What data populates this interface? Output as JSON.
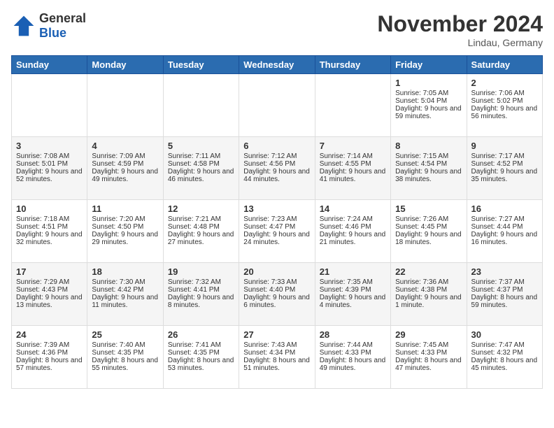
{
  "header": {
    "logo_general": "General",
    "logo_blue": "Blue",
    "month_title": "November 2024",
    "location": "Lindau, Germany"
  },
  "weekdays": [
    "Sunday",
    "Monday",
    "Tuesday",
    "Wednesday",
    "Thursday",
    "Friday",
    "Saturday"
  ],
  "weeks": [
    {
      "days": [
        {
          "num": "",
          "sunrise": "",
          "sunset": "",
          "daylight": ""
        },
        {
          "num": "",
          "sunrise": "",
          "sunset": "",
          "daylight": ""
        },
        {
          "num": "",
          "sunrise": "",
          "sunset": "",
          "daylight": ""
        },
        {
          "num": "",
          "sunrise": "",
          "sunset": "",
          "daylight": ""
        },
        {
          "num": "",
          "sunrise": "",
          "sunset": "",
          "daylight": ""
        },
        {
          "num": "1",
          "sunrise": "Sunrise: 7:05 AM",
          "sunset": "Sunset: 5:04 PM",
          "daylight": "Daylight: 9 hours and 59 minutes."
        },
        {
          "num": "2",
          "sunrise": "Sunrise: 7:06 AM",
          "sunset": "Sunset: 5:02 PM",
          "daylight": "Daylight: 9 hours and 56 minutes."
        }
      ]
    },
    {
      "days": [
        {
          "num": "3",
          "sunrise": "Sunrise: 7:08 AM",
          "sunset": "Sunset: 5:01 PM",
          "daylight": "Daylight: 9 hours and 52 minutes."
        },
        {
          "num": "4",
          "sunrise": "Sunrise: 7:09 AM",
          "sunset": "Sunset: 4:59 PM",
          "daylight": "Daylight: 9 hours and 49 minutes."
        },
        {
          "num": "5",
          "sunrise": "Sunrise: 7:11 AM",
          "sunset": "Sunset: 4:58 PM",
          "daylight": "Daylight: 9 hours and 46 minutes."
        },
        {
          "num": "6",
          "sunrise": "Sunrise: 7:12 AM",
          "sunset": "Sunset: 4:56 PM",
          "daylight": "Daylight: 9 hours and 44 minutes."
        },
        {
          "num": "7",
          "sunrise": "Sunrise: 7:14 AM",
          "sunset": "Sunset: 4:55 PM",
          "daylight": "Daylight: 9 hours and 41 minutes."
        },
        {
          "num": "8",
          "sunrise": "Sunrise: 7:15 AM",
          "sunset": "Sunset: 4:54 PM",
          "daylight": "Daylight: 9 hours and 38 minutes."
        },
        {
          "num": "9",
          "sunrise": "Sunrise: 7:17 AM",
          "sunset": "Sunset: 4:52 PM",
          "daylight": "Daylight: 9 hours and 35 minutes."
        }
      ]
    },
    {
      "days": [
        {
          "num": "10",
          "sunrise": "Sunrise: 7:18 AM",
          "sunset": "Sunset: 4:51 PM",
          "daylight": "Daylight: 9 hours and 32 minutes."
        },
        {
          "num": "11",
          "sunrise": "Sunrise: 7:20 AM",
          "sunset": "Sunset: 4:50 PM",
          "daylight": "Daylight: 9 hours and 29 minutes."
        },
        {
          "num": "12",
          "sunrise": "Sunrise: 7:21 AM",
          "sunset": "Sunset: 4:48 PM",
          "daylight": "Daylight: 9 hours and 27 minutes."
        },
        {
          "num": "13",
          "sunrise": "Sunrise: 7:23 AM",
          "sunset": "Sunset: 4:47 PM",
          "daylight": "Daylight: 9 hours and 24 minutes."
        },
        {
          "num": "14",
          "sunrise": "Sunrise: 7:24 AM",
          "sunset": "Sunset: 4:46 PM",
          "daylight": "Daylight: 9 hours and 21 minutes."
        },
        {
          "num": "15",
          "sunrise": "Sunrise: 7:26 AM",
          "sunset": "Sunset: 4:45 PM",
          "daylight": "Daylight: 9 hours and 18 minutes."
        },
        {
          "num": "16",
          "sunrise": "Sunrise: 7:27 AM",
          "sunset": "Sunset: 4:44 PM",
          "daylight": "Daylight: 9 hours and 16 minutes."
        }
      ]
    },
    {
      "days": [
        {
          "num": "17",
          "sunrise": "Sunrise: 7:29 AM",
          "sunset": "Sunset: 4:43 PM",
          "daylight": "Daylight: 9 hours and 13 minutes."
        },
        {
          "num": "18",
          "sunrise": "Sunrise: 7:30 AM",
          "sunset": "Sunset: 4:42 PM",
          "daylight": "Daylight: 9 hours and 11 minutes."
        },
        {
          "num": "19",
          "sunrise": "Sunrise: 7:32 AM",
          "sunset": "Sunset: 4:41 PM",
          "daylight": "Daylight: 9 hours and 8 minutes."
        },
        {
          "num": "20",
          "sunrise": "Sunrise: 7:33 AM",
          "sunset": "Sunset: 4:40 PM",
          "daylight": "Daylight: 9 hours and 6 minutes."
        },
        {
          "num": "21",
          "sunrise": "Sunrise: 7:35 AM",
          "sunset": "Sunset: 4:39 PM",
          "daylight": "Daylight: 9 hours and 4 minutes."
        },
        {
          "num": "22",
          "sunrise": "Sunrise: 7:36 AM",
          "sunset": "Sunset: 4:38 PM",
          "daylight": "Daylight: 9 hours and 1 minute."
        },
        {
          "num": "23",
          "sunrise": "Sunrise: 7:37 AM",
          "sunset": "Sunset: 4:37 PM",
          "daylight": "Daylight: 8 hours and 59 minutes."
        }
      ]
    },
    {
      "days": [
        {
          "num": "24",
          "sunrise": "Sunrise: 7:39 AM",
          "sunset": "Sunset: 4:36 PM",
          "daylight": "Daylight: 8 hours and 57 minutes."
        },
        {
          "num": "25",
          "sunrise": "Sunrise: 7:40 AM",
          "sunset": "Sunset: 4:35 PM",
          "daylight": "Daylight: 8 hours and 55 minutes."
        },
        {
          "num": "26",
          "sunrise": "Sunrise: 7:41 AM",
          "sunset": "Sunset: 4:35 PM",
          "daylight": "Daylight: 8 hours and 53 minutes."
        },
        {
          "num": "27",
          "sunrise": "Sunrise: 7:43 AM",
          "sunset": "Sunset: 4:34 PM",
          "daylight": "Daylight: 8 hours and 51 minutes."
        },
        {
          "num": "28",
          "sunrise": "Sunrise: 7:44 AM",
          "sunset": "Sunset: 4:33 PM",
          "daylight": "Daylight: 8 hours and 49 minutes."
        },
        {
          "num": "29",
          "sunrise": "Sunrise: 7:45 AM",
          "sunset": "Sunset: 4:33 PM",
          "daylight": "Daylight: 8 hours and 47 minutes."
        },
        {
          "num": "30",
          "sunrise": "Sunrise: 7:47 AM",
          "sunset": "Sunset: 4:32 PM",
          "daylight": "Daylight: 8 hours and 45 minutes."
        }
      ]
    }
  ]
}
